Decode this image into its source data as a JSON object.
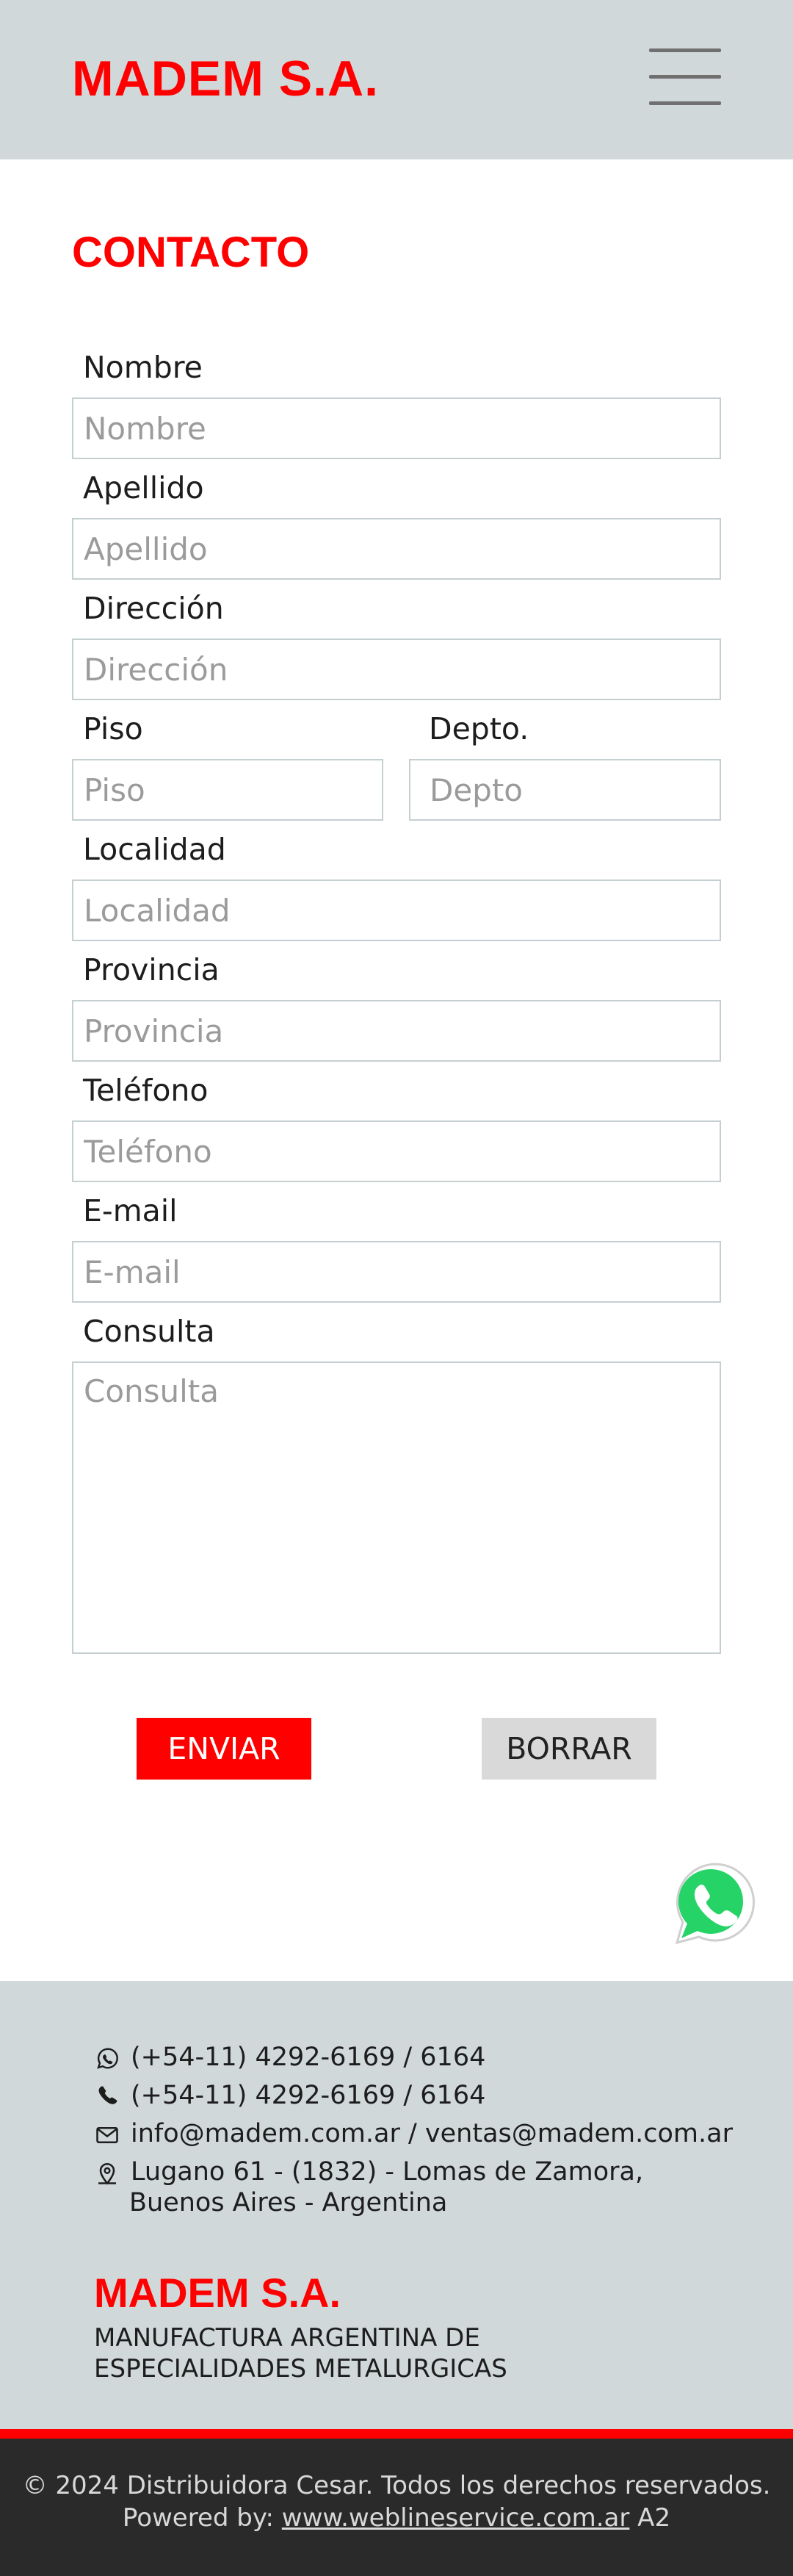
{
  "header": {
    "logo": "MADEM S.A.",
    "menu_icon": "hamburger-menu-icon"
  },
  "page_title": "CONTACTO",
  "form": {
    "nombre": {
      "label": "Nombre",
      "placeholder": "Nombre"
    },
    "apellido": {
      "label": "Apellido",
      "placeholder": "Apellido"
    },
    "direccion": {
      "label": "Dirección",
      "placeholder": "Dirección"
    },
    "piso": {
      "label": "Piso",
      "placeholder": "Piso"
    },
    "depto": {
      "label": "Depto.",
      "placeholder": "Depto"
    },
    "localidad": {
      "label": "Localidad",
      "placeholder": "Localidad"
    },
    "provincia": {
      "label": "Provincia",
      "placeholder": "Provincia"
    },
    "telefono": {
      "label": "Teléfono",
      "placeholder": "Teléfono"
    },
    "email": {
      "label": "E-mail",
      "placeholder": "E-mail"
    },
    "consulta": {
      "label": "Consulta",
      "placeholder": "Consulta"
    },
    "send_label": "ENVIAR",
    "clear_label": "BORRAR"
  },
  "whatsapp_icon": "whatsapp-icon",
  "footer": {
    "whatsapp_phone": "(+54-11) 4292-6169 / 6164",
    "phone": "(+54-11) 4292-6169 / 6164",
    "email": "info@madem.com.ar / ventas@madem.com.ar",
    "address_line1": "Lugano 61 - (1832) - Lomas de Zamora,",
    "address_line2": "Buenos Aires - Argentina",
    "logo": "MADEM S.A.",
    "tagline_line1": "MANUFACTURA ARGENTINA DE",
    "tagline_line2": "ESPECIALIDADES METALURGICAS"
  },
  "bottom_bar": {
    "copyright": "© 2024 Distribuidora Cesar. Todos los derechos reservados.",
    "powered_prefix": "Powered by: ",
    "powered_link": "www.weblineservice.com.ar",
    "powered_suffix": " A2"
  },
  "colors": {
    "brand_red": "#ff0000",
    "header_bg": "#d0d8da",
    "bottom_bg": "#2a2a2a",
    "whatsapp_green": "#25d366"
  }
}
